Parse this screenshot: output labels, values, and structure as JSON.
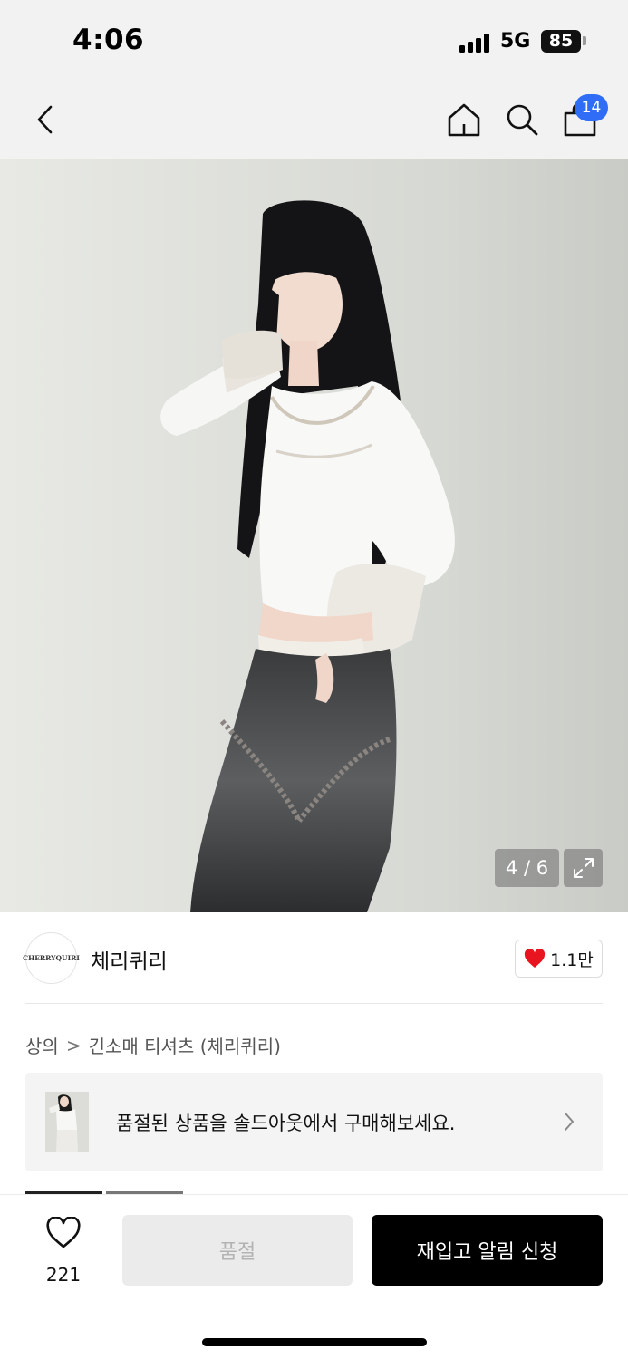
{
  "status_bar": {
    "time": "4:06",
    "network": "5G",
    "battery": "85"
  },
  "header": {
    "back_icon": "chevron-left-icon",
    "home_icon": "home-icon",
    "search_icon": "search-icon",
    "cart_icon": "shopping-bag-icon",
    "cart_count": "14",
    "badge_color": "#2f6df6"
  },
  "gallery": {
    "counter": "4 / 6",
    "current": 4,
    "total": 6,
    "expand_icon": "expand-icon"
  },
  "brand": {
    "name": "체리퀴리",
    "logo_text": "CHERRYQUIRI",
    "likes": "1.1만",
    "like_icon": "heart-filled-icon",
    "heart_color": "#e8141f"
  },
  "breadcrumb": {
    "items": [
      "상의",
      "긴소매 티셔츠 (체리퀴리)"
    ],
    "separator": ">"
  },
  "soldout_banner": {
    "text": "품절된 상품을 솔드아웃에서 구매해보세요.",
    "chevron_icon": "chevron-right-icon"
  },
  "bottom_bar": {
    "wish_icon": "heart-outline-icon",
    "wish_count": "221",
    "soldout_label": "품절",
    "restock_label": "재입고 알림 신청"
  }
}
